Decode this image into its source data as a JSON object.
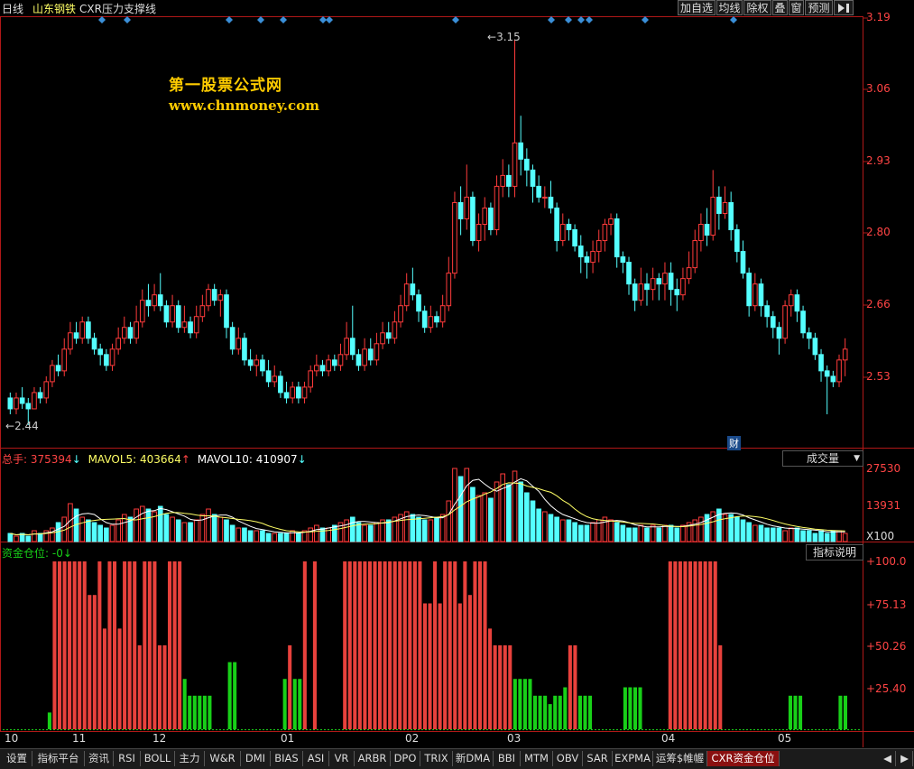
{
  "header": {
    "period": "日线",
    "stock": "山东钢铁",
    "indicator": "CXR压力支撑线",
    "buttons": [
      "加自选",
      "均线",
      "除权",
      "叠",
      "窗",
      "预测"
    ],
    "menu_icon": "arrow-menu-icon"
  },
  "watermark": {
    "line1": "第一股票公式网",
    "line2": "www.chnmoney.com"
  },
  "price_panel": {
    "y_ticks": [
      "3.19",
      "3.06",
      "2.93",
      "2.80",
      "2.66",
      "2.53"
    ],
    "high_marker": "3.15",
    "low_marker": "2.44",
    "finance_tag": "财"
  },
  "volume_panel": {
    "label_total": "总手:",
    "total_value": "375394",
    "label_ma5": "MAVOL5:",
    "ma5_value": "403664",
    "label_ma10": "MAVOL10:",
    "ma10_value": "410907",
    "selector": "成交量",
    "y_ticks": [
      "27530",
      "13931"
    ],
    "unit": "X100"
  },
  "fund_panel": {
    "label": "资金仓位:",
    "value": "-0",
    "help_button": "指标说明",
    "y_ticks": [
      "+100.0",
      "+75.13",
      "+50.26",
      "+25.40"
    ]
  },
  "x_axis": {
    "labels": [
      "10",
      "11",
      "12",
      "01",
      "02",
      "03",
      "04",
      "05"
    ]
  },
  "tabs": [
    "设置",
    "指标平台",
    "资讯",
    "RSI",
    "BOLL",
    "主力",
    "W&R",
    "DMI",
    "BIAS",
    "ASI",
    "VR",
    "ARBR",
    "DPO",
    "TRIX",
    "新DMA",
    "BBI",
    "MTM",
    "OBV",
    "SAR",
    "EXPMA",
    "运筹$帷幄",
    "CXR资金仓位"
  ],
  "active_tab": "CXR资金仓位",
  "colors": {
    "up": "#ff3b3b",
    "down": "#54ffff",
    "fund_red": "#e8413c",
    "fund_green": "#18d018",
    "frame": "#b01818",
    "ma5": "#ffffff",
    "ma10": "#ffff66"
  },
  "chart_data": {
    "type": "candlestick",
    "price_range": [
      2.44,
      3.19
    ],
    "candles": [
      [
        2.49,
        2.47,
        2.5,
        2.46
      ],
      [
        2.47,
        2.49,
        2.5,
        2.46
      ],
      [
        2.49,
        2.48,
        2.51,
        2.47
      ],
      [
        2.48,
        2.47,
        2.49,
        2.44
      ],
      [
        2.47,
        2.5,
        2.51,
        2.47
      ],
      [
        2.5,
        2.49,
        2.51,
        2.48
      ],
      [
        2.49,
        2.52,
        2.53,
        2.48
      ],
      [
        2.52,
        2.55,
        2.56,
        2.51
      ],
      [
        2.55,
        2.54,
        2.57,
        2.53
      ],
      [
        2.54,
        2.58,
        2.6,
        2.53
      ],
      [
        2.58,
        2.61,
        2.63,
        2.57
      ],
      [
        2.61,
        2.6,
        2.63,
        2.59
      ],
      [
        2.6,
        2.63,
        2.64,
        2.59
      ],
      [
        2.63,
        2.6,
        2.64,
        2.59
      ],
      [
        2.6,
        2.58,
        2.61,
        2.57
      ],
      [
        2.58,
        2.57,
        2.59,
        2.55
      ],
      [
        2.57,
        2.55,
        2.58,
        2.54
      ],
      [
        2.55,
        2.58,
        2.59,
        2.54
      ],
      [
        2.58,
        2.6,
        2.62,
        2.57
      ],
      [
        2.6,
        2.62,
        2.64,
        2.59
      ],
      [
        2.62,
        2.6,
        2.63,
        2.59
      ],
      [
        2.6,
        2.63,
        2.66,
        2.59
      ],
      [
        2.63,
        2.67,
        2.69,
        2.62
      ],
      [
        2.67,
        2.66,
        2.7,
        2.64
      ],
      [
        2.66,
        2.68,
        2.7,
        2.65
      ],
      [
        2.68,
        2.66,
        2.72,
        2.65
      ],
      [
        2.66,
        2.63,
        2.67,
        2.62
      ],
      [
        2.63,
        2.66,
        2.68,
        2.62
      ],
      [
        2.66,
        2.62,
        2.67,
        2.61
      ],
      [
        2.62,
        2.63,
        2.66,
        2.61
      ],
      [
        2.63,
        2.61,
        2.64,
        2.6
      ],
      [
        2.61,
        2.64,
        2.66,
        2.6
      ],
      [
        2.64,
        2.66,
        2.68,
        2.63
      ],
      [
        2.66,
        2.69,
        2.7,
        2.65
      ],
      [
        2.69,
        2.67,
        2.7,
        2.66
      ],
      [
        2.67,
        2.68,
        2.69,
        2.64
      ],
      [
        2.68,
        2.62,
        2.69,
        2.6
      ],
      [
        2.62,
        2.58,
        2.63,
        2.57
      ],
      [
        2.58,
        2.6,
        2.62,
        2.57
      ],
      [
        2.6,
        2.56,
        2.61,
        2.55
      ],
      [
        2.56,
        2.55,
        2.58,
        2.54
      ],
      [
        2.55,
        2.56,
        2.57,
        2.53
      ],
      [
        2.56,
        2.54,
        2.57,
        2.53
      ],
      [
        2.54,
        2.52,
        2.56,
        2.51
      ],
      [
        2.52,
        2.53,
        2.55,
        2.51
      ],
      [
        2.53,
        2.5,
        2.54,
        2.49
      ],
      [
        2.5,
        2.49,
        2.52,
        2.48
      ],
      [
        2.49,
        2.51,
        2.52,
        2.48
      ],
      [
        2.51,
        2.49,
        2.52,
        2.48
      ],
      [
        2.49,
        2.51,
        2.52,
        2.48
      ],
      [
        2.51,
        2.54,
        2.55,
        2.5
      ],
      [
        2.54,
        2.55,
        2.57,
        2.53
      ],
      [
        2.55,
        2.54,
        2.56,
        2.53
      ],
      [
        2.54,
        2.56,
        2.57,
        2.53
      ],
      [
        2.56,
        2.55,
        2.57,
        2.54
      ],
      [
        2.55,
        2.57,
        2.59,
        2.54
      ],
      [
        2.57,
        2.6,
        2.63,
        2.56
      ],
      [
        2.6,
        2.57,
        2.66,
        2.56
      ],
      [
        2.57,
        2.55,
        2.58,
        2.54
      ],
      [
        2.55,
        2.58,
        2.6,
        2.54
      ],
      [
        2.58,
        2.56,
        2.6,
        2.55
      ],
      [
        2.56,
        2.59,
        2.61,
        2.55
      ],
      [
        2.59,
        2.61,
        2.63,
        2.58
      ],
      [
        2.61,
        2.6,
        2.63,
        2.59
      ],
      [
        2.6,
        2.63,
        2.65,
        2.59
      ],
      [
        2.63,
        2.66,
        2.68,
        2.62
      ],
      [
        2.66,
        2.7,
        2.72,
        2.65
      ],
      [
        2.7,
        2.68,
        2.73,
        2.67
      ],
      [
        2.68,
        2.65,
        2.69,
        2.63
      ],
      [
        2.65,
        2.62,
        2.66,
        2.61
      ],
      [
        2.62,
        2.64,
        2.66,
        2.61
      ],
      [
        2.64,
        2.63,
        2.65,
        2.62
      ],
      [
        2.63,
        2.66,
        2.68,
        2.62
      ],
      [
        2.66,
        2.72,
        2.75,
        2.65
      ],
      [
        2.72,
        2.85,
        2.87,
        2.71
      ],
      [
        2.85,
        2.82,
        2.88,
        2.79
      ],
      [
        2.82,
        2.86,
        2.92,
        2.8
      ],
      [
        2.86,
        2.78,
        2.87,
        2.77
      ],
      [
        2.78,
        2.81,
        2.83,
        2.76
      ],
      [
        2.81,
        2.84,
        2.86,
        2.78
      ],
      [
        2.84,
        2.8,
        2.85,
        2.79
      ],
      [
        2.8,
        2.88,
        2.9,
        2.79
      ],
      [
        2.88,
        2.9,
        2.93,
        2.86
      ],
      [
        2.9,
        2.88,
        2.92,
        2.86
      ],
      [
        2.88,
        2.96,
        3.15,
        2.86
      ],
      [
        2.96,
        2.93,
        3.01,
        2.9
      ],
      [
        2.93,
        2.91,
        2.95,
        2.88
      ],
      [
        2.91,
        2.88,
        2.92,
        2.85
      ],
      [
        2.88,
        2.86,
        2.9,
        2.85
      ],
      [
        2.86,
        2.86,
        2.88,
        2.84
      ],
      [
        2.86,
        2.84,
        2.89,
        2.83
      ],
      [
        2.84,
        2.78,
        2.85,
        2.76
      ],
      [
        2.78,
        2.81,
        2.83,
        2.77
      ],
      [
        2.81,
        2.8,
        2.82,
        2.78
      ],
      [
        2.8,
        2.77,
        2.81,
        2.76
      ],
      [
        2.77,
        2.75,
        2.79,
        2.72
      ],
      [
        2.75,
        2.74,
        2.76,
        2.71
      ],
      [
        2.74,
        2.76,
        2.78,
        2.72
      ],
      [
        2.76,
        2.78,
        2.8,
        2.74
      ],
      [
        2.78,
        2.81,
        2.82,
        2.76
      ],
      [
        2.81,
        2.82,
        2.83,
        2.79
      ],
      [
        2.82,
        2.75,
        2.83,
        2.73
      ],
      [
        2.75,
        2.74,
        2.76,
        2.72
      ],
      [
        2.74,
        2.7,
        2.75,
        2.68
      ],
      [
        2.7,
        2.67,
        2.71,
        2.65
      ],
      [
        2.67,
        2.7,
        2.73,
        2.66
      ],
      [
        2.7,
        2.69,
        2.72,
        2.66
      ],
      [
        2.69,
        2.71,
        2.73,
        2.67
      ],
      [
        2.71,
        2.7,
        2.72,
        2.67
      ],
      [
        2.7,
        2.72,
        2.74,
        2.67
      ],
      [
        2.72,
        2.69,
        2.74,
        2.66
      ],
      [
        2.69,
        2.68,
        2.71,
        2.65
      ],
      [
        2.68,
        2.71,
        2.73,
        2.67
      ],
      [
        2.71,
        2.73,
        2.76,
        2.7
      ],
      [
        2.73,
        2.78,
        2.8,
        2.72
      ],
      [
        2.78,
        2.81,
        2.83,
        2.76
      ],
      [
        2.81,
        2.79,
        2.84,
        2.77
      ],
      [
        2.79,
        2.86,
        2.91,
        2.78
      ],
      [
        2.86,
        2.83,
        2.88,
        2.8
      ],
      [
        2.83,
        2.85,
        2.88,
        2.82
      ],
      [
        2.85,
        2.8,
        2.87,
        2.78
      ],
      [
        2.8,
        2.76,
        2.81,
        2.74
      ],
      [
        2.76,
        2.72,
        2.78,
        2.71
      ],
      [
        2.72,
        2.66,
        2.73,
        2.64
      ],
      [
        2.66,
        2.7,
        2.72,
        2.65
      ],
      [
        2.7,
        2.66,
        2.71,
        2.64
      ],
      [
        2.66,
        2.64,
        2.67,
        2.62
      ],
      [
        2.64,
        2.62,
        2.65,
        2.6
      ],
      [
        2.62,
        2.6,
        2.63,
        2.57
      ],
      [
        2.6,
        2.66,
        2.67,
        2.59
      ],
      [
        2.66,
        2.68,
        2.69,
        2.64
      ],
      [
        2.68,
        2.65,
        2.69,
        2.63
      ],
      [
        2.65,
        2.61,
        2.66,
        2.6
      ],
      [
        2.61,
        2.6,
        2.62,
        2.58
      ],
      [
        2.6,
        2.57,
        2.61,
        2.56
      ],
      [
        2.57,
        2.54,
        2.58,
        2.52
      ],
      [
        2.54,
        2.53,
        2.55,
        2.46
      ],
      [
        2.53,
        2.52,
        2.54,
        2.51
      ],
      [
        2.52,
        2.56,
        2.57,
        2.51
      ],
      [
        2.56,
        2.58,
        2.6,
        2.53
      ]
    ],
    "volume": [
      3,
      2,
      3,
      2,
      4,
      3,
      4,
      5,
      7,
      9,
      14,
      12,
      9,
      8,
      7,
      6,
      5,
      6,
      8,
      10,
      9,
      12,
      13,
      12,
      11,
      13,
      10,
      9,
      8,
      7,
      7,
      8,
      10,
      12,
      10,
      9,
      8,
      6,
      5,
      5,
      4,
      4,
      4,
      3,
      3,
      3,
      3,
      4,
      3,
      4,
      5,
      6,
      5,
      5,
      6,
      7,
      8,
      9,
      7,
      6,
      6,
      7,
      8,
      8,
      9,
      10,
      11,
      10,
      9,
      8,
      8,
      9,
      10,
      15,
      27,
      24,
      27,
      20,
      17,
      18,
      16,
      22,
      25,
      21,
      26,
      22,
      18,
      15,
      12,
      11,
      10,
      9,
      8,
      8,
      7,
      6,
      6,
      7,
      8,
      9,
      8,
      7,
      6,
      5,
      5,
      6,
      5,
      6,
      5,
      6,
      6,
      5,
      6,
      7,
      8,
      9,
      10,
      11,
      12,
      10,
      10,
      9,
      8,
      7,
      6,
      6,
      5,
      5,
      5,
      4,
      5,
      5,
      4,
      4,
      3,
      4,
      3,
      4,
      4,
      3
    ],
    "volume_max": 27530,
    "fund_position": [
      0,
      0,
      0,
      0,
      0,
      0,
      0,
      0,
      10,
      100,
      100,
      100,
      100,
      100,
      100,
      100,
      80,
      80,
      100,
      60,
      100,
      100,
      60,
      100,
      100,
      100,
      50,
      100,
      100,
      100,
      50,
      50,
      100,
      100,
      100,
      30,
      20,
      20,
      20,
      20,
      20,
      0,
      0,
      0,
      40,
      40,
      0,
      0,
      0,
      0,
      0,
      0,
      0,
      0,
      0,
      30,
      50,
      30,
      30,
      100,
      0,
      100,
      0,
      0,
      0,
      0,
      0,
      100,
      100,
      100,
      100,
      100,
      100,
      100,
      100,
      100,
      100,
      100,
      100,
      100,
      100,
      100,
      100,
      75,
      75,
      100,
      75,
      100,
      100,
      100,
      75,
      100,
      80,
      100,
      100,
      100,
      60,
      50,
      50,
      50,
      50,
      30,
      30,
      30,
      30,
      20,
      20,
      20,
      15,
      20,
      20,
      25,
      50,
      50,
      20,
      20,
      20,
      0,
      0,
      0,
      0,
      0,
      0,
      25,
      25,
      25,
      25,
      0,
      0,
      0,
      0,
      0,
      100,
      100,
      100,
      100,
      100,
      100,
      100,
      100,
      100,
      100,
      50,
      0,
      0,
      0,
      0,
      0,
      0,
      0,
      0,
      0,
      0,
      0,
      0,
      0,
      20,
      20,
      20,
      0,
      0,
      0,
      0,
      0,
      0,
      0,
      20,
      20
    ],
    "fund_range": [
      0,
      100
    ],
    "x_labels": [
      "10",
      "11",
      "12",
      "01",
      "02",
      "03",
      "04",
      "05"
    ]
  }
}
